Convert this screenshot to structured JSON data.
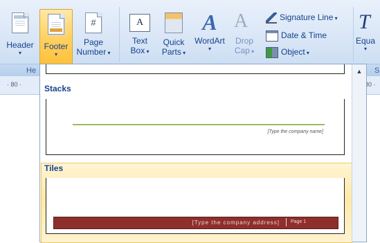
{
  "ribbon": {
    "buttons": {
      "header": "Header",
      "footer": "Footer",
      "page_line1": "Page",
      "page_line2": "Number",
      "text_line1": "Text",
      "text_line2": "Box",
      "quick_line1": "Quick",
      "quick_line2": "Parts",
      "wordart": "WordArt",
      "drop_line1": "Drop",
      "drop_line2": "Cap",
      "equation": "Equa",
      "signature_line": "Signature Line",
      "date_time": "Date & Time",
      "object": "Object"
    },
    "icon_glyphs": {
      "page_number": "#",
      "text_box": "A",
      "wordart": "A",
      "drop_cap": "A",
      "equation": "T"
    },
    "group_labels": {
      "header_footer": "He",
      "right_cut": "S"
    }
  },
  "ruler": {
    "left": "· 80 ·",
    "right": "80 ·"
  },
  "gallery": {
    "section_stacks": "Stacks",
    "section_tiles": "Tiles",
    "stacks_placeholder": "[Type the company name]",
    "tiles_placeholder": "[Type the company address]",
    "tiles_page": "Page 1"
  },
  "colors": {
    "accent_gold": "#ffc13a",
    "stacks_line_green": "#9bbb59",
    "tiles_red": "#8e2f2b",
    "ribbon_blue": "#dbe7f7"
  }
}
